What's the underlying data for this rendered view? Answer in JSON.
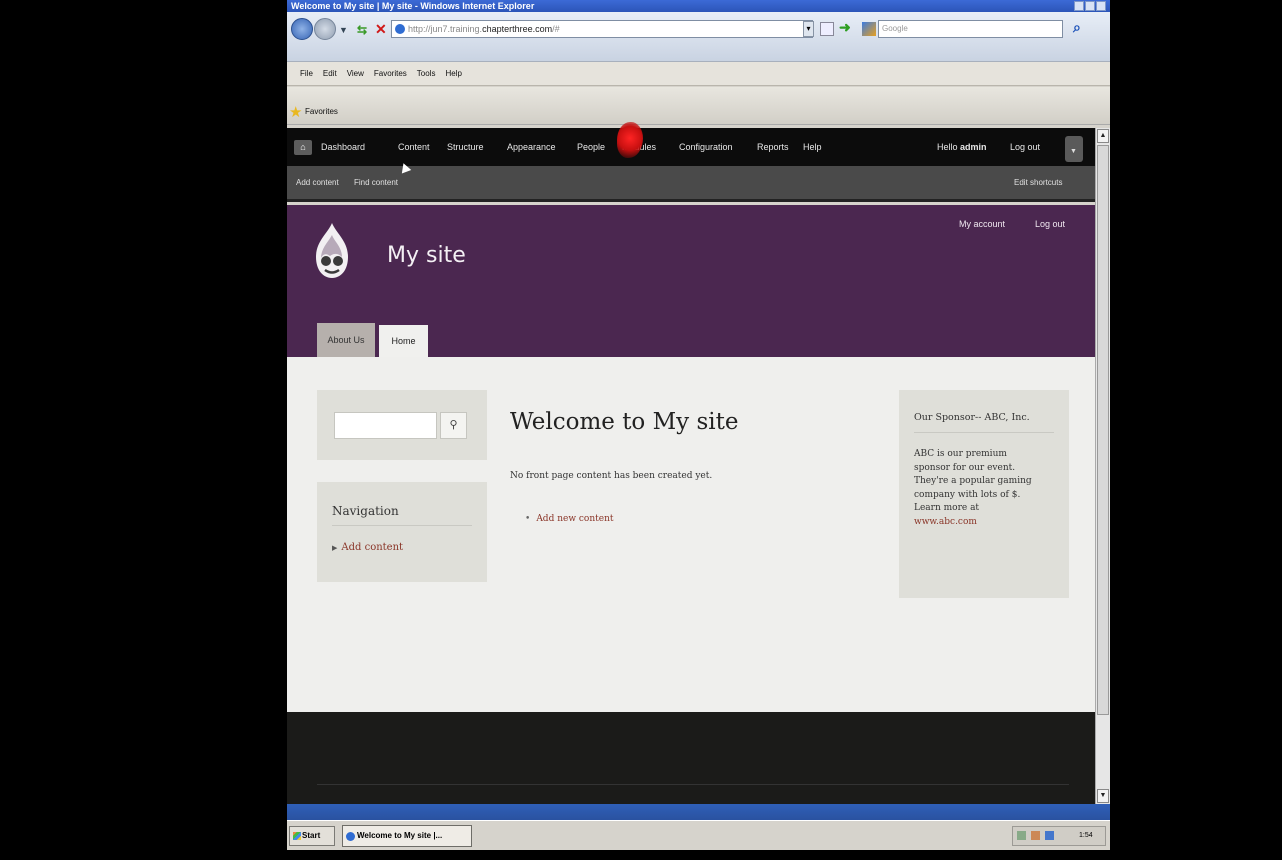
{
  "window": {
    "title": "Welcome to My site | My site - Windows Internet Explorer"
  },
  "browser": {
    "url_prefix": "http://jun7.training.",
    "url_host": "chapterthree.com",
    "url_suffix": "/#",
    "search_placeholder": "Google",
    "menu": [
      "File",
      "Edit",
      "View",
      "Favorites",
      "Tools",
      "Help"
    ],
    "favorites_label": "Favorites"
  },
  "toolbar": {
    "items": [
      "Dashboard",
      "Content",
      "Structure",
      "Appearance",
      "People",
      "Modules",
      "Configuration",
      "Reports",
      "Help"
    ],
    "hello_prefix": "Hello ",
    "user": "admin",
    "logout": "Log out",
    "shortcuts": [
      "Add content",
      "Find content"
    ],
    "edit_shortcuts": "Edit shortcuts"
  },
  "header": {
    "site_name": "My site",
    "my_account": "My account",
    "logout": "Log out",
    "tabs": [
      "About Us",
      "Home"
    ]
  },
  "sidebar": {
    "navigation_title": "Navigation",
    "navigation_link": "Add content"
  },
  "main": {
    "title": "Welcome to My site",
    "message": "No front page content has been created yet.",
    "add_link": "Add new content"
  },
  "sponsor": {
    "title": "Our Sponsor-- ABC, Inc.",
    "lines": [
      "ABC is our premium",
      "sponsor for our event.",
      "They're a popular gaming",
      "company with lots of $.",
      "Learn more at"
    ],
    "link": "www.abc.com"
  },
  "taskbar": {
    "start": "Start",
    "task": "Welcome to My site |...",
    "clock": "1:54 PM"
  },
  "colors": {
    "header_purple": "#4b2750",
    "toolbar_black": "#0c0c0c",
    "link_red": "#8a3528"
  }
}
